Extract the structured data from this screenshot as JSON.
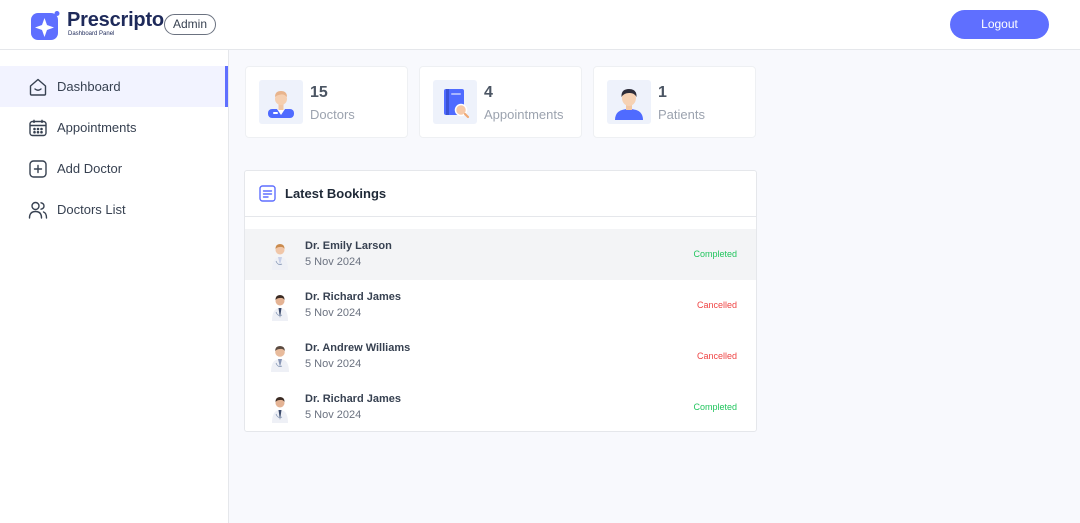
{
  "header": {
    "brand": "Prescripto",
    "brand_sub": "Dashboard Panel",
    "role_badge": "Admin",
    "logout_label": "Logout"
  },
  "colors": {
    "primary": "#5f6fff",
    "completed": "#22c55e",
    "cancelled": "#ef4444",
    "main_bg": "#f8f9fd"
  },
  "sidebar": {
    "items": [
      {
        "label": "Dashboard",
        "icon": "home-icon",
        "active": true
      },
      {
        "label": "Appointments",
        "icon": "calendar-icon",
        "active": false
      },
      {
        "label": "Add Doctor",
        "icon": "add-icon",
        "active": false
      },
      {
        "label": "Doctors List",
        "icon": "people-icon",
        "active": false
      }
    ]
  },
  "stats": [
    {
      "value": "15",
      "label": "Doctors",
      "icon": "doctor-icon"
    },
    {
      "value": "4",
      "label": "Appointments",
      "icon": "appointments-icon"
    },
    {
      "value": "1",
      "label": "Patients",
      "icon": "patient-icon"
    }
  ],
  "bookings": {
    "title": "Latest Bookings",
    "rows": [
      {
        "name": "Dr. Emily Larson",
        "date": "5 Nov 2024",
        "status": "Completed"
      },
      {
        "name": "Dr. Richard James",
        "date": "5 Nov 2024",
        "status": "Cancelled"
      },
      {
        "name": "Dr. Andrew Williams",
        "date": "5 Nov 2024",
        "status": "Cancelled"
      },
      {
        "name": "Dr. Richard James",
        "date": "5 Nov 2024",
        "status": "Completed"
      }
    ]
  }
}
